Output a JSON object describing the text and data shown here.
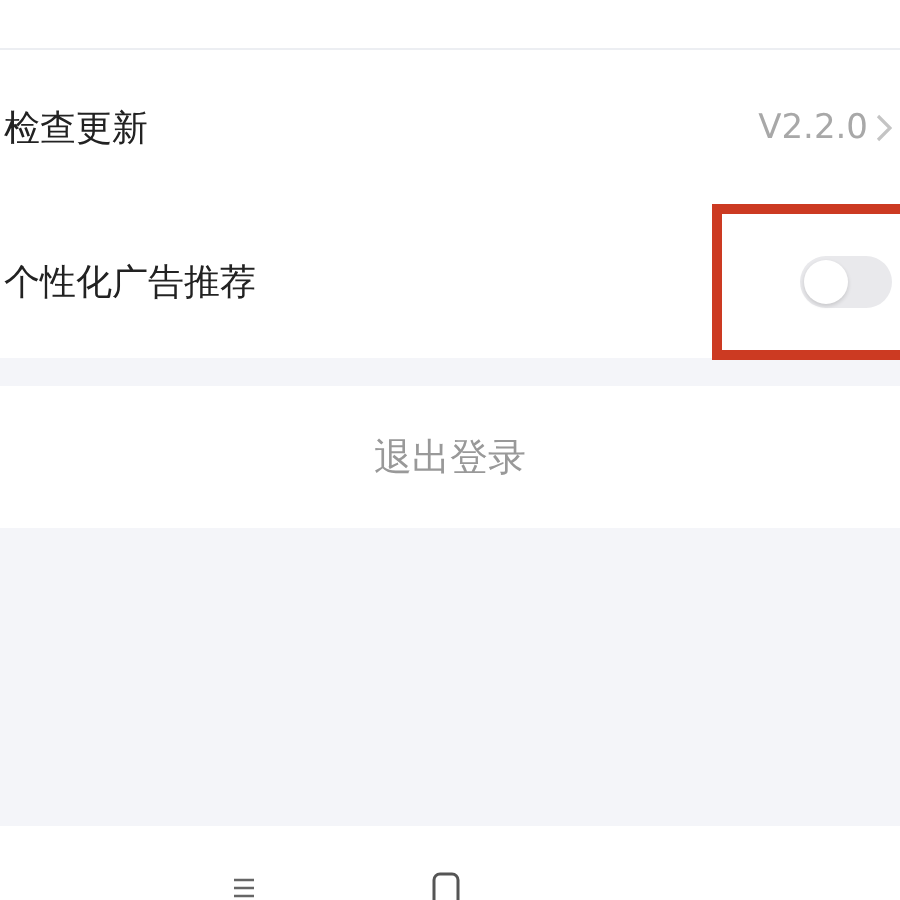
{
  "settings": [
    {
      "kind": "link",
      "label": "检查更新",
      "value": "V2.2.0"
    },
    {
      "kind": "switch",
      "label": "个性化广告推荐",
      "on": false,
      "highlighted": true
    }
  ],
  "logout_button": {
    "label": "退出登录"
  }
}
